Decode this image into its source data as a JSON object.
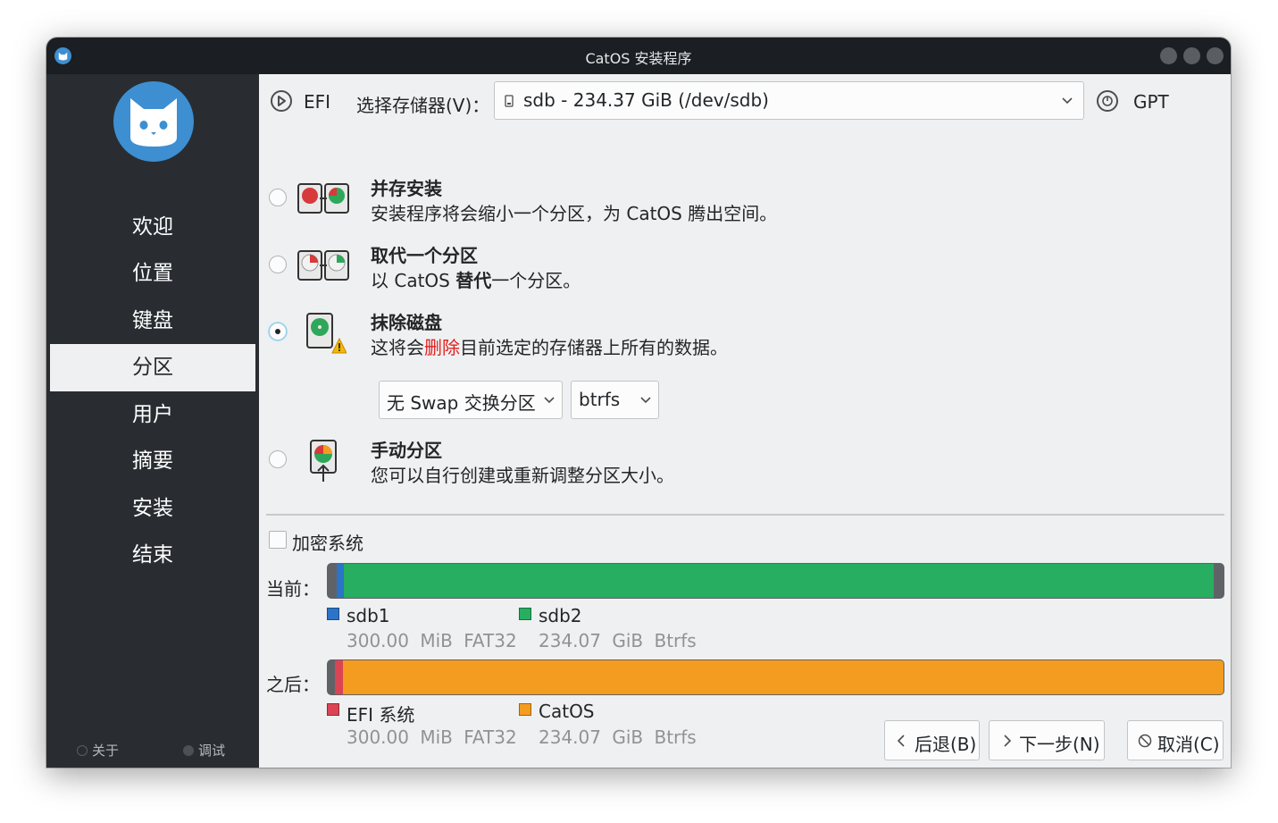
{
  "window": {
    "title": "CatOS 安装程序",
    "logo": "cat-logo-icon"
  },
  "sidebar": {
    "items": [
      {
        "label": "欢迎"
      },
      {
        "label": "位置"
      },
      {
        "label": "键盘"
      },
      {
        "label": "分区",
        "active": true
      },
      {
        "label": "用户"
      },
      {
        "label": "摘要"
      },
      {
        "label": "安装"
      },
      {
        "label": "结束"
      }
    ],
    "about_label": "关于",
    "debug_label": "调试"
  },
  "top": {
    "efi_label": "EFI",
    "storage_label": "选择存储器(V)：",
    "storage_value": "sdb - 234.37 GiB (/dev/sdb)",
    "table_type": "GPT"
  },
  "options": [
    {
      "title": "并存安装",
      "desc": "安装程序将会缩小一个分区，为 CatOS 腾出空间。",
      "selected": false,
      "icon": "alongside-disks-icon"
    },
    {
      "title": "取代一个分区",
      "desc_prefix": "以 CatOS ",
      "desc_bold": "替代",
      "desc_suffix": "一个分区。",
      "selected": false,
      "icon": "replace-disks-icon"
    },
    {
      "title": "抹除磁盘",
      "desc_prefix": "这将会",
      "desc_red": "删除",
      "desc_suffix": "目前选定的存储器上所有的数据。",
      "selected": true,
      "icon": "erase-disk-warning-icon"
    },
    {
      "title": "手动分区",
      "desc": "您可以自行创建或重新调整分区大小。",
      "selected": false,
      "icon": "manual-partition-icon"
    }
  ],
  "erase_options": {
    "swap": "无 Swap 交换分区",
    "filesystem": "btrfs"
  },
  "encrypt": {
    "label": "加密系统",
    "checked": false
  },
  "current": {
    "label": "当前：",
    "partitions": [
      {
        "name": "sdb1",
        "size": "300.00 MiB",
        "fs": "FAT32",
        "color": "#2b74c7"
      },
      {
        "name": "sdb2",
        "size": "234.07 GiB",
        "fs": "Btrfs",
        "color": "#27ae60"
      }
    ]
  },
  "after": {
    "label": "之后：",
    "partitions": [
      {
        "name": "EFI 系统",
        "size": "300.00 MiB",
        "fs": "FAT32",
        "color": "#da4453"
      },
      {
        "name": "CatOS",
        "size": "234.07 GiB",
        "fs": "Btrfs",
        "color": "#f39c1f"
      }
    ]
  },
  "buttons": {
    "back": "后退(B)",
    "next": "下一步(N)",
    "cancel": "取消(C)"
  }
}
